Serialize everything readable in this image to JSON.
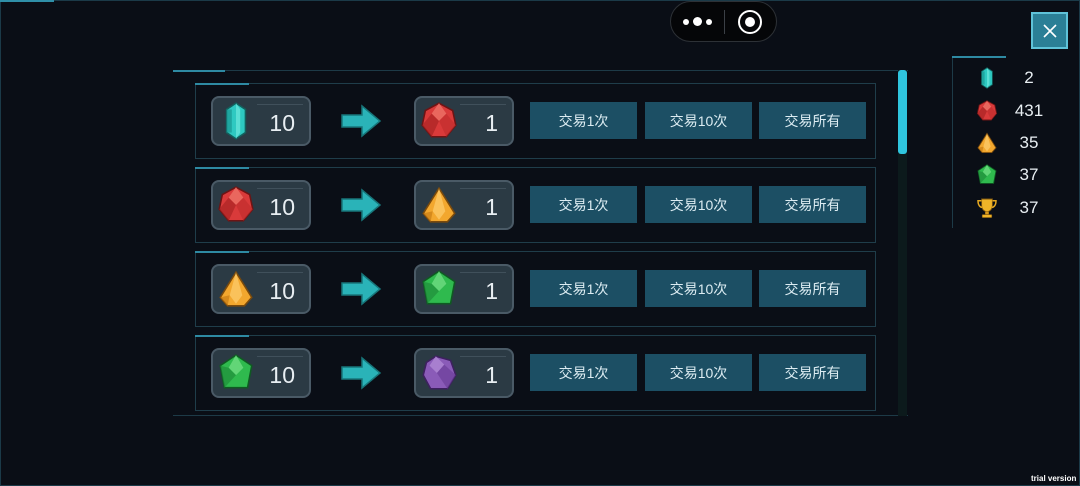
{
  "close_icon": "close-icon",
  "menu": {
    "more_icon": "more-dots-icon",
    "exit_icon": "target-circle-icon"
  },
  "gems": {
    "cyan": {
      "name": "crystal",
      "color": "#2ec9c1"
    },
    "red": {
      "name": "ruby",
      "color": "#d93a3a"
    },
    "orange": {
      "name": "amber",
      "color": "#f2a72e"
    },
    "green": {
      "name": "emerald",
      "color": "#2fba4e"
    },
    "purple": {
      "name": "amethyst",
      "color": "#8a5bb8"
    }
  },
  "trades": [
    {
      "from_gem": "cyan",
      "from_count": "10",
      "to_gem": "red",
      "to_count": "1",
      "buttons": [
        "交易1次",
        "交易10次",
        "交易所有"
      ]
    },
    {
      "from_gem": "red",
      "from_count": "10",
      "to_gem": "orange",
      "to_count": "1",
      "buttons": [
        "交易1次",
        "交易10次",
        "交易所有"
      ]
    },
    {
      "from_gem": "orange",
      "from_count": "10",
      "to_gem": "green",
      "to_count": "1",
      "buttons": [
        "交易1次",
        "交易10次",
        "交易所有"
      ]
    },
    {
      "from_gem": "green",
      "from_count": "10",
      "to_gem": "purple",
      "to_count": "1",
      "buttons": [
        "交易1次",
        "交易10次",
        "交易所有"
      ]
    }
  ],
  "inventory": [
    {
      "item": "cyan",
      "count": "2"
    },
    {
      "item": "red",
      "count": "431"
    },
    {
      "item": "orange",
      "count": "35"
    },
    {
      "item": "green",
      "count": "37"
    },
    {
      "item": "trophy",
      "count": "37"
    }
  ],
  "footer": {
    "trial_text": "trial version"
  },
  "colors": {
    "button_bg": "#1c4f64",
    "accent": "#2fc5de",
    "background": "#0a0e16"
  }
}
